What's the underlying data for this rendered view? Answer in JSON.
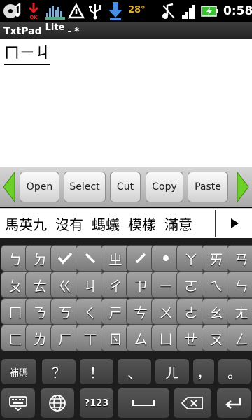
{
  "status_bar": {
    "temperature": "28°",
    "time": "0:58",
    "icons": [
      "music-icon",
      "download-ok-icon",
      "equalizer-icon",
      "usb-debug-icon",
      "usb-icon",
      "download-icon",
      "no-music-icon",
      "signal-icon",
      "battery-charging-icon"
    ],
    "notification_badge": "OK"
  },
  "title_bar": {
    "app_name": "TxtPad",
    "edition": "Lite",
    "modified": "- *"
  },
  "editor": {
    "text": "ㄇㄧㄐ"
  },
  "toolbar": {
    "buttons": [
      "Open",
      "Select",
      "Cut",
      "Copy",
      "Paste"
    ],
    "accent_color": "#6dd028"
  },
  "candidate_bar": {
    "candidates": [
      "馬英九",
      "沒有",
      "螞蟻",
      "模樣",
      "滿意"
    ],
    "more_icon": "triangle-right-icon"
  },
  "keyboard": {
    "rows": [
      [
        "ㄅ",
        "ㄉ",
        "ˇ",
        "ˋ",
        "ㄓ",
        "ˊ",
        "˙",
        "ㄚ",
        "ㄞ",
        "ㄢ"
      ],
      [
        "ㄆ",
        "ㄊ",
        "ㄍ",
        "ㄐ",
        "ㄔ",
        "ㄗ",
        "ㄧ",
        "ㄛ",
        "ㄟ",
        "ㄣ"
      ],
      [
        "ㄇ",
        "ㄋ",
        "ㄎ",
        "ㄑ",
        "ㄕ",
        "ㄘ",
        "ㄨ",
        "ㄜ",
        "ㄠ",
        "ㄤ"
      ],
      [
        "ㄈ",
        "ㄌ",
        "ㄏ",
        "ㄒ",
        "ㄖ",
        "ㄙ",
        "ㄩ",
        "ㄝ",
        "ㄡ",
        "ㄥ"
      ]
    ],
    "row5": [
      "補碼",
      "？",
      "！",
      "、",
      "ㄦ",
      "，",
      "。"
    ],
    "row6": {
      "keyboard_icon": "keyboard-icon",
      "globe_icon": "globe-icon",
      "numeric": "?123",
      "space_icon": "space-icon",
      "backspace_icon": "backspace-icon",
      "enter_icon": "enter-icon"
    }
  }
}
